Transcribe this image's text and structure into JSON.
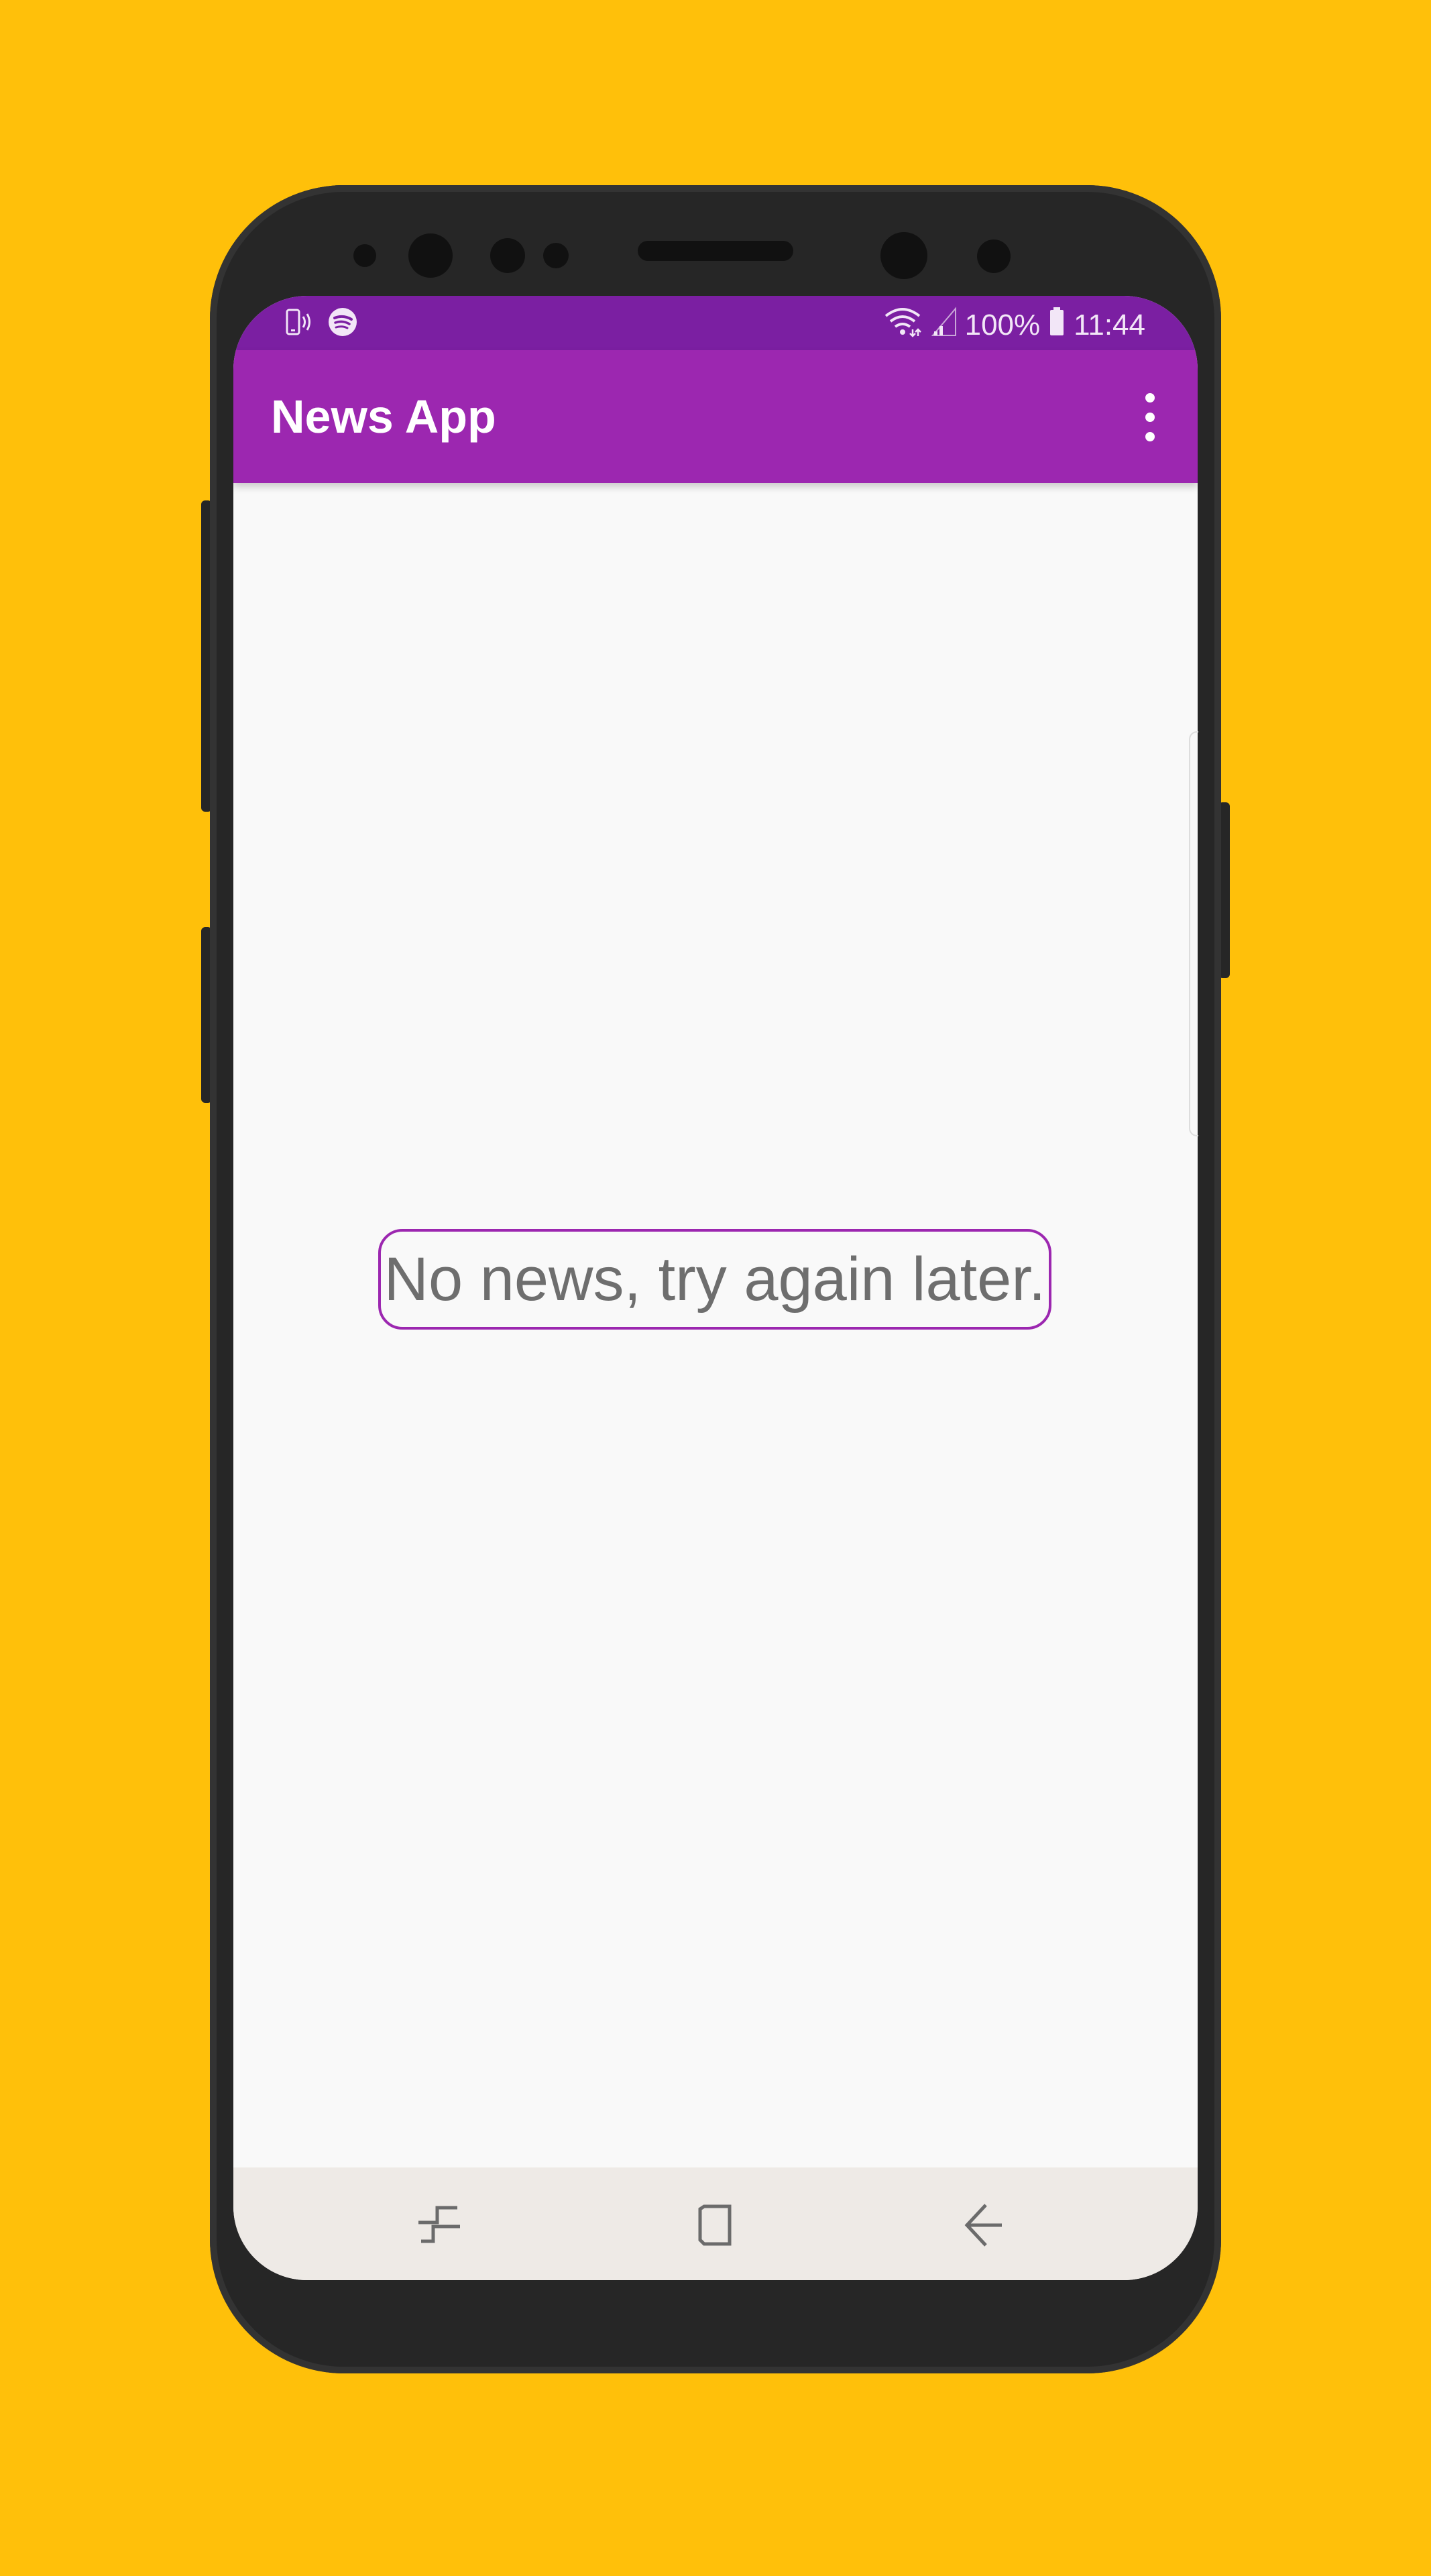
{
  "status_bar": {
    "battery": "100%",
    "time": "11:44",
    "left_icons": [
      "vibrate-phone-icon",
      "spotify-icon"
    ],
    "right_icons": [
      "wifi-icon",
      "signal-icon",
      "battery-icon"
    ]
  },
  "app_bar": {
    "title": "News App",
    "overflow_icon": "more-vert-icon"
  },
  "main": {
    "empty_message": "No news, try again later."
  },
  "nav_bar": {
    "icons": [
      "recents-icon",
      "home-icon",
      "back-icon"
    ]
  },
  "colors": {
    "background": "#FFC00A",
    "status_bar": "#7B1FA2",
    "app_bar": "#9C27B0",
    "message_border": "#9C27B0",
    "message_text": "#6E6E6E",
    "nav_bar": "#EEEAE6"
  }
}
